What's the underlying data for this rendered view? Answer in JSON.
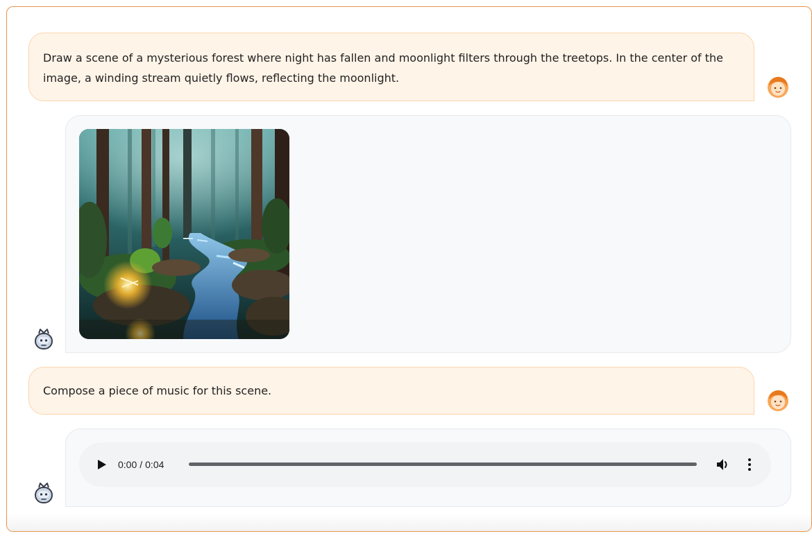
{
  "messages": {
    "user_1": "Draw a scene of a mysterious forest where night has fallen and moonlight filters through the treetops. In the center of the image, a winding stream quietly flows, reflecting the moonlight.",
    "user_2": "Compose a piece of music for this scene."
  },
  "image": {
    "icon": "generated-forest-stream-image"
  },
  "audio": {
    "current_time": "0:00",
    "separator": "/",
    "duration": "0:04",
    "progress": 0
  },
  "avatars": {
    "user": "user-avatar-icon",
    "bot": "robot-avatar-icon"
  },
  "colors": {
    "frame_border": "#e8944a",
    "user_bubble_bg": "#fff4e8",
    "user_bubble_border": "#fbd5ad",
    "bot_bubble_bg": "#f8f9fb",
    "player_bg": "#f1f3f4"
  }
}
